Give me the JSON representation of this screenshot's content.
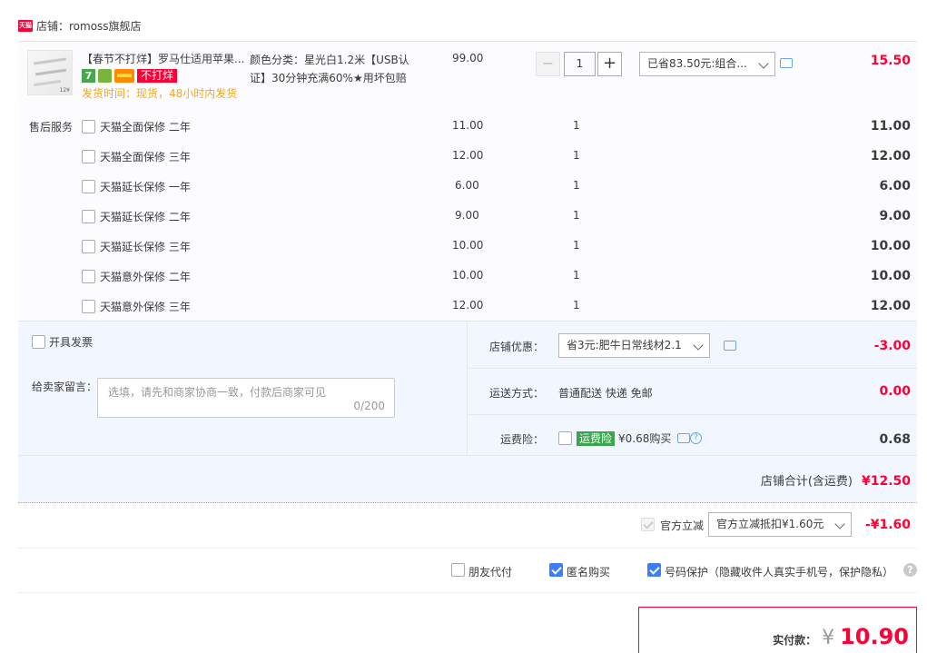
{
  "shop": {
    "badge": "天猫",
    "label": "店铺：romoss旗舰店"
  },
  "item": {
    "title": "【春节不打烊】罗马仕适用苹果...",
    "badges": {
      "seven": "7",
      "no_close": "不打烊"
    },
    "ship_time": "发货时间：现货，48小时内发货",
    "sku_line1": "颜色分类：星光白1.2米【USB认",
    "sku_line2": "证】30分钟充满60%★用坏包赔",
    "price": "99.00",
    "qty_minus": "−",
    "qty": "1",
    "qty_plus": "+",
    "discount_select": "已省83.50元:组合...",
    "subtotal": "15.50",
    "thumb_tag": "12¥"
  },
  "services": {
    "label": "售后服务",
    "rows": [
      {
        "name": "天猫全面保修 二年",
        "price": "11.00",
        "qty": "1",
        "sum": "11.00"
      },
      {
        "name": "天猫全面保修 三年",
        "price": "12.00",
        "qty": "1",
        "sum": "12.00"
      },
      {
        "name": "天猫延长保修 一年",
        "price": "6.00",
        "qty": "1",
        "sum": "6.00"
      },
      {
        "name": "天猫延长保修 二年",
        "price": "9.00",
        "qty": "1",
        "sum": "9.00"
      },
      {
        "name": "天猫延长保修 三年",
        "price": "10.00",
        "qty": "1",
        "sum": "10.00"
      },
      {
        "name": "天猫意外保修 二年",
        "price": "10.00",
        "qty": "1",
        "sum": "10.00"
      },
      {
        "name": "天猫意外保修 三年",
        "price": "12.00",
        "qty": "1",
        "sum": "12.00"
      }
    ]
  },
  "order": {
    "invoice_label": "开具发票",
    "memo_label": "给卖家留言：",
    "memo_placeholder": "选填，请先和商家协商一致，付款后商家可见",
    "memo_count": "0/200",
    "coupon_label": "店铺优惠：",
    "coupon_select": "省3元:肥牛日常线材2.1",
    "coupon_amount": "-3.00",
    "shipping_label": "运送方式：",
    "shipping_value": "普通配送 快递 免邮",
    "shipping_amount": "0.00",
    "insurance_label": "运费险：",
    "insurance_tag": "运费险",
    "insurance_text": "¥0.68购买",
    "insurance_amount": "0.68",
    "insurance_help": "?",
    "total_label": "店铺合计(含运费)",
    "total_amount": "¥12.50"
  },
  "official": {
    "label": "官方立减",
    "select": "官方立减抵扣¥1.60元",
    "amount": "-¥1.60"
  },
  "options": {
    "friend_pay": "朋友代付",
    "anonymous": "匿名购买",
    "number_protect": "号码保护（隐藏收件人真实手机号，保护隐私）",
    "help": "?"
  },
  "payment": {
    "label": "实付款：",
    "currency": "¥",
    "amount": "10.90"
  },
  "colors": {
    "accent_red": "#ff0036",
    "checkbox_blue": "#3d7df5",
    "ship_orange": "#f5a623",
    "insurance_green": "#3aa54c"
  }
}
